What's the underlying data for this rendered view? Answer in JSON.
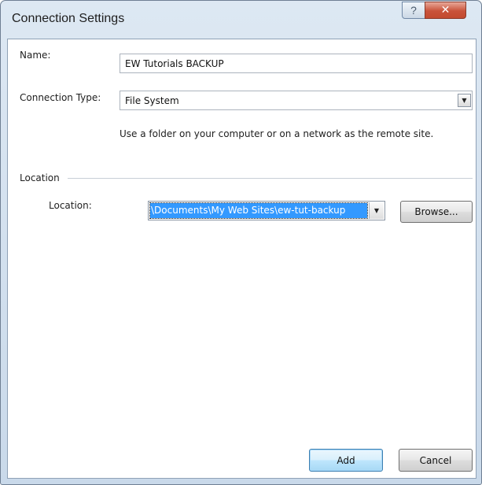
{
  "window": {
    "title": "Connection Settings",
    "help_glyph": "?",
    "close_glyph": "✕"
  },
  "form": {
    "name_label": "Name:",
    "name_value": "EW Tutorials BACKUP",
    "connection_type_label": "Connection Type:",
    "connection_type_value": "File System",
    "connection_type_description": "Use a folder on your computer or on a network as the remote site.",
    "location_group_title": "Location",
    "location_label": "Location:",
    "location_value": "\\Documents\\My Web Sites\\ew-tut-backup",
    "browse_label": "Browse..."
  },
  "footer": {
    "add_label": "Add",
    "cancel_label": "Cancel"
  },
  "icons": {
    "dropdown_arrow": "▼"
  }
}
